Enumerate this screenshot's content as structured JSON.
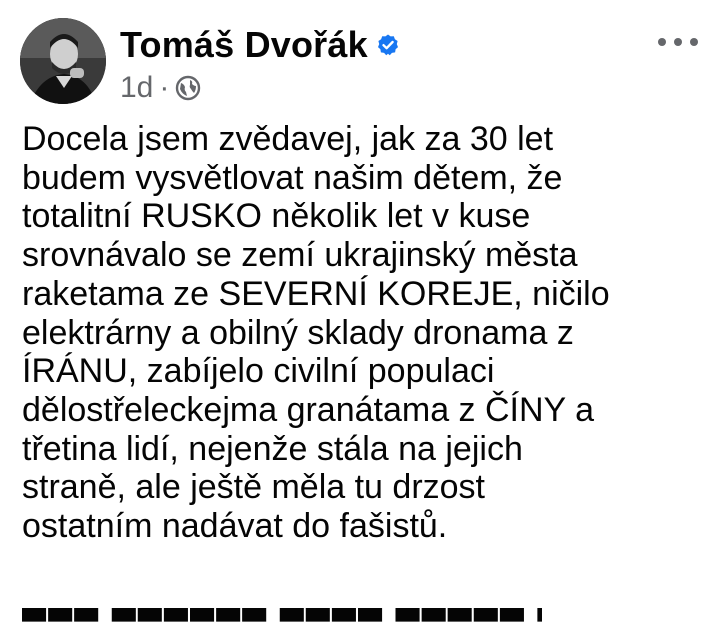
{
  "post": {
    "author": "Tomáš Dvořák",
    "verified": true,
    "time": "1d",
    "separator": "·",
    "audience_icon": "globe-icon",
    "more_icon": "more-options-icon",
    "text_lines": [
      "Docela jsem zvědavej, jak za 30 let",
      "budem vysvětlovat našim dětem, že",
      "totalitní RUSKO několik let v kuse",
      "srovnávalo se zemí ukrajinský města",
      "raketama ze SEVERNÍ KOREJE, ničilo",
      "elektrárny a obilný sklady dronama z",
      "ÍRÁNU, zabíjelo civilní populaci",
      "dělostřeleckejma granátama z ČÍNY a",
      "třetina lidí, nejenže stála na jejich",
      "straně, ale ještě měla tu drzost",
      "ostatním nadávat do fašistů."
    ]
  },
  "colors": {
    "text": "#050505",
    "secondary": "#65676b",
    "verified_badge": "#1877f2",
    "background": "#ffffff"
  }
}
